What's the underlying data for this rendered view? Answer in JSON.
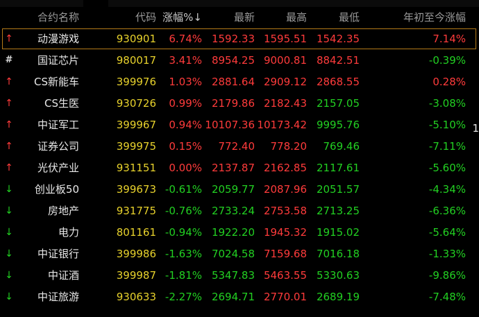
{
  "header": {
    "name": "合约名称",
    "code": "代码",
    "change": "涨幅%↓",
    "last": "最新",
    "high": "最高",
    "low": "最低",
    "ytd": "年初至今涨幅"
  },
  "colors": {
    "up": "#ff3b3b",
    "down": "#22d022",
    "code": "#e8d22c",
    "selection": "#b47a18"
  },
  "rows": [
    {
      "icon": "up-arrow-icon",
      "mark": "↑",
      "name": "动漫游戏",
      "code": "930901",
      "change": "6.74%",
      "last": "1592.33",
      "high": "1595.51",
      "low": "1542.35",
      "ytd": "7.14%"
    },
    {
      "icon": "hash-icon",
      "mark": "#",
      "name": "国证芯片",
      "code": "980017",
      "change": "3.41%",
      "last": "8954.25",
      "high": "9000.81",
      "low": "8842.51",
      "ytd": "-0.39%"
    },
    {
      "icon": "up-arrow-icon",
      "mark": "↑",
      "name": "CS新能车",
      "code": "399976",
      "change": "1.03%",
      "last": "2881.64",
      "high": "2909.12",
      "low": "2868.55",
      "ytd": "0.28%"
    },
    {
      "icon": "up-arrow-icon",
      "mark": "↑",
      "name": "CS生医",
      "code": "930726",
      "change": "0.99%",
      "last": "2179.86",
      "high": "2182.43",
      "low": "2157.05",
      "ytd": "-3.08%"
    },
    {
      "icon": "up-arrow-icon",
      "mark": "↑",
      "name": "中证军工",
      "code": "399967",
      "change": "0.94%",
      "last": "10107.36",
      "high": "10173.42",
      "low": "9995.76",
      "ytd": "-5.10%"
    },
    {
      "icon": "up-arrow-icon",
      "mark": "↑",
      "name": "证券公司",
      "code": "399975",
      "change": "0.15%",
      "last": "772.40",
      "high": "778.20",
      "low": "769.46",
      "ytd": "-7.11%"
    },
    {
      "icon": "up-arrow-icon",
      "mark": "↑",
      "name": "光伏产业",
      "code": "931151",
      "change": "0.00%",
      "last": "2137.87",
      "high": "2162.85",
      "low": "2117.61",
      "ytd": "-5.60%"
    },
    {
      "icon": "down-arrow-icon",
      "mark": "↓",
      "name": "创业板50",
      "code": "399673",
      "change": "-0.61%",
      "last": "2059.77",
      "high": "2087.96",
      "low": "2051.57",
      "ytd": "-4.34%"
    },
    {
      "icon": "down-arrow-icon",
      "mark": "↓",
      "name": "房地产",
      "code": "931775",
      "change": "-0.76%",
      "last": "2733.24",
      "high": "2753.58",
      "low": "2713.25",
      "ytd": "-6.36%"
    },
    {
      "icon": "down-arrow-icon",
      "mark": "↓",
      "name": "电力",
      "code": "801161",
      "change": "-0.94%",
      "last": "1922.20",
      "high": "1945.32",
      "low": "1915.02",
      "ytd": "-5.64%"
    },
    {
      "icon": "down-arrow-icon",
      "mark": "↓",
      "name": "中证银行",
      "code": "399986",
      "change": "-1.63%",
      "last": "7024.58",
      "high": "7159.68",
      "low": "7016.18",
      "ytd": "-1.33%"
    },
    {
      "icon": "down-arrow-icon",
      "mark": "↓",
      "name": "中证酒",
      "code": "399987",
      "change": "-1.81%",
      "last": "5347.83",
      "high": "5463.55",
      "low": "5330.63",
      "ytd": "-9.86%"
    },
    {
      "icon": "down-arrow-icon",
      "mark": "↓",
      "name": "中证旅游",
      "code": "930633",
      "change": "-2.27%",
      "last": "2694.71",
      "high": "2770.01",
      "low": "2689.19",
      "ytd": "-7.48%"
    }
  ],
  "edge_text": "1"
}
